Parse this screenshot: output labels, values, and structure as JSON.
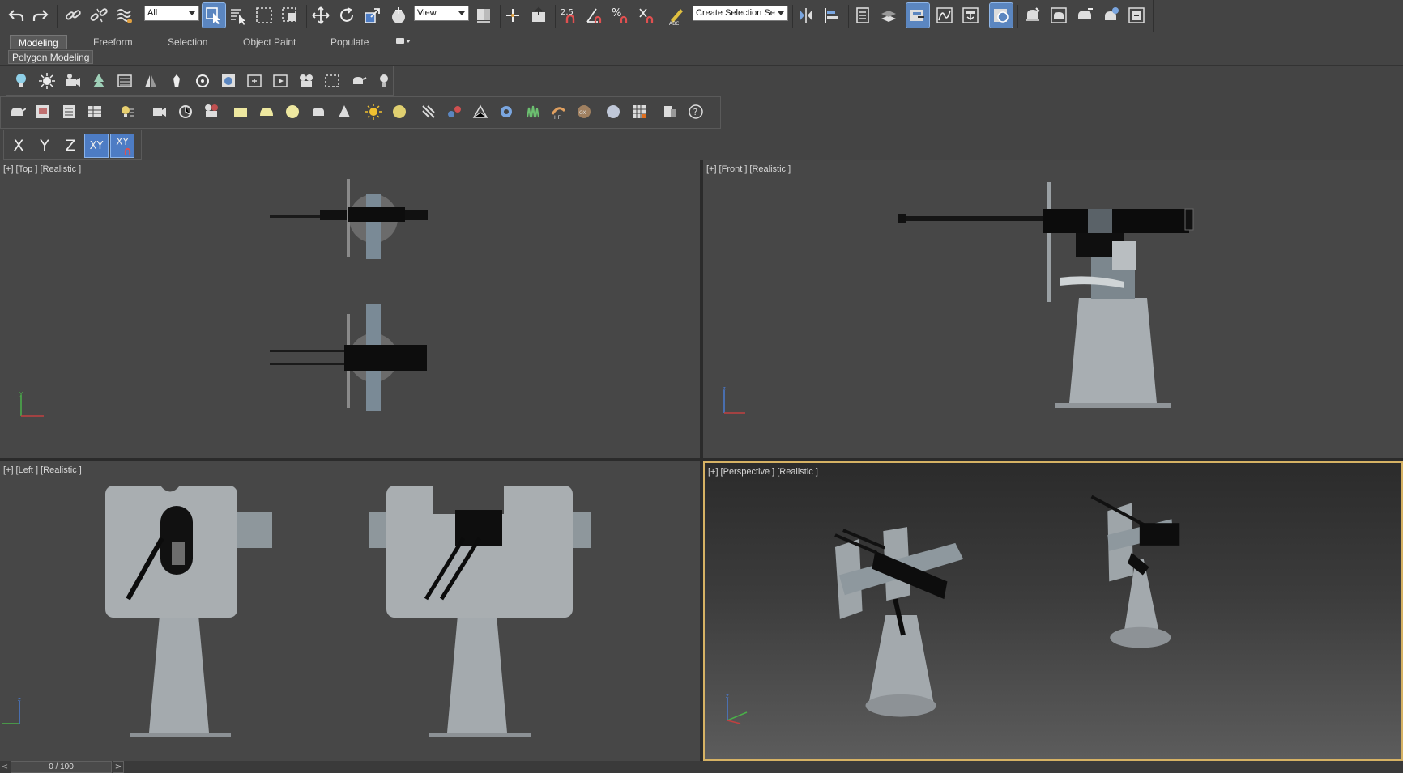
{
  "toolbar": {
    "selection_filter": "All",
    "reference_coord": "View",
    "named_selection": "Create Selection Se",
    "snap_2d_label": "2.5",
    "icons": [
      "undo-icon",
      "redo-icon",
      "link-icon",
      "unlink-icon",
      "bind-space-warp-icon",
      "select-object-icon",
      "select-by-name-icon",
      "rect-selection-icon",
      "window-crossing-icon",
      "move-icon",
      "rotate-icon",
      "scale-icon",
      "placement-icon",
      "pivot-icon",
      "manipulate-icon",
      "snap-icon",
      "angle-snap-icon",
      "percent-snap-icon",
      "spinner-snap-icon",
      "edit-named-selection-icon",
      "mirror-icon",
      "align-icon",
      "layer-explorer-icon",
      "toggle-ribbon-icon",
      "scene-explorer-icon",
      "curve-editor-icon",
      "schematic-view-icon",
      "material-editor-icon",
      "render-setup-icon",
      "rendered-frame-icon",
      "render-icon",
      "render-cloud-icon",
      "render-iterative-icon"
    ]
  },
  "ribbon": {
    "tabs": [
      "Modeling",
      "Freeform",
      "Selection",
      "Object Paint",
      "Populate"
    ],
    "active_tab": "Modeling",
    "panel_label": "Polygon Modeling"
  },
  "axis_constraints": {
    "x": "X",
    "y": "Y",
    "z": "Z",
    "xy": "XY",
    "xy_snap": "XY"
  },
  "viewports": {
    "top": [
      "[+]",
      "[Top ]",
      "[Realistic ]"
    ],
    "front": [
      "[+]",
      "[Front ]",
      "[Realistic ]"
    ],
    "left": [
      "[+]",
      "[Left ]",
      "[Realistic ]"
    ],
    "perspective": [
      "[+]",
      "[Perspective ]",
      "[Realistic ]"
    ]
  },
  "timeline": {
    "frame_display": "0 / 100",
    "prev": "<",
    "next": ">"
  },
  "colors": {
    "ui_background": "#444444",
    "active_button": "#5b86c0",
    "active_viewport_border": "#d6b264",
    "viewport_background": "#474747"
  }
}
